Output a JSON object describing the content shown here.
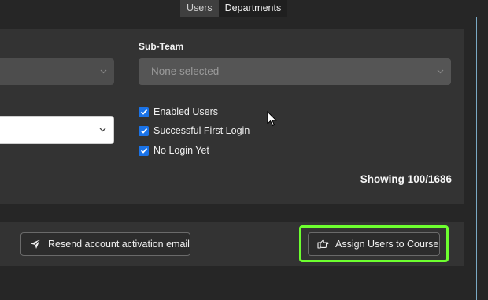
{
  "tabs": [
    {
      "label": "Users"
    },
    {
      "label": "Departments"
    }
  ],
  "filters": {
    "subteam_label": "Sub-Team",
    "subteam_placeholder": "None selected",
    "checkboxes": [
      {
        "label": "Enabled Users",
        "checked": true
      },
      {
        "label": "Successful First Login",
        "checked": true
      },
      {
        "label": "No Login Yet",
        "checked": true
      }
    ]
  },
  "showing": "Showing 100/1686",
  "actions": {
    "resend_label": "Resend account activation email",
    "assign_label": "Assign Users to Course"
  },
  "colors": {
    "highlight": "#6dff2f",
    "checkbox": "#1a73e8"
  }
}
